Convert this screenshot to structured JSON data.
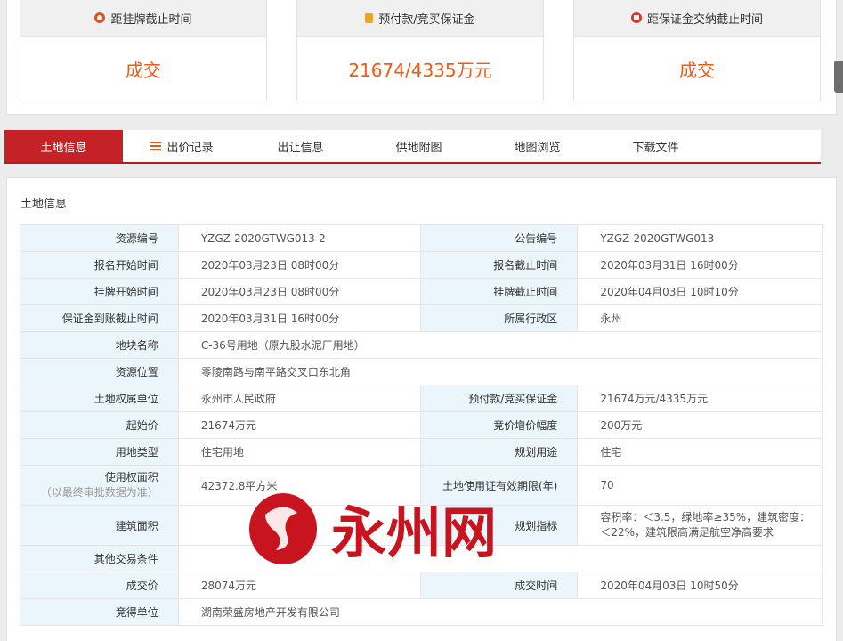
{
  "status_cards": [
    {
      "icon": "clock-icon",
      "label": "距挂牌截止时间",
      "value": "成交"
    },
    {
      "icon": "coin-icon",
      "label": "预付款/竞买保证金",
      "value": "21674/4335万元"
    },
    {
      "icon": "calendar-icon",
      "label": "距保证金交纳截止时间",
      "value": "成交"
    }
  ],
  "tabs": [
    {
      "label": "土地信息",
      "active": true
    },
    {
      "label": "出价记录",
      "icon": "list-icon"
    },
    {
      "label": "出让信息"
    },
    {
      "label": "供地附图"
    },
    {
      "label": "地图浏览"
    },
    {
      "label": "下载文件"
    }
  ],
  "panel": {
    "title": "土地信息",
    "rows": {
      "r1": {
        "l1": "资源编号",
        "v1": "YZGZ-2020GTWG013-2",
        "l2": "公告编号",
        "v2": "YZGZ-2020GTWG013"
      },
      "r2": {
        "l1": "报名开始时间",
        "v1": "2020年03月23日 08时00分",
        "l2": "报名截止时间",
        "v2": "2020年03月31日 16时00分"
      },
      "r3": {
        "l1": "挂牌开始时间",
        "v1": "2020年03月23日 08时00分",
        "l2": "挂牌截止时间",
        "v2": "2020年04月03日 10时10分"
      },
      "r4": {
        "l1": "保证金到账截止时间",
        "v1": "2020年03月31日 16时00分",
        "l2": "所属行政区",
        "v2": "永州"
      },
      "r5": {
        "l1": "地块名称",
        "v1": "C-36号用地（原九股水泥厂用地）"
      },
      "r6": {
        "l1": "资源位置",
        "v1": "零陵南路与南平路交叉口东北角"
      },
      "r7": {
        "l1": "土地权属单位",
        "v1": "永州市人民政府",
        "l2": "预付款/竞买保证金",
        "v2": "21674万元/4335万元"
      },
      "r8": {
        "l1": "起始价",
        "v1": "21674万元",
        "l2": "竞价增价幅度",
        "v2": "200万元"
      },
      "r9": {
        "l1": "用地类型",
        "v1": "住宅用地",
        "l2": "规划用途",
        "v2": "住宅"
      },
      "r10": {
        "l1": "使用权面积",
        "l1_sub": "（以最终审批数据为准）",
        "v1": "42372.8平方米",
        "l2": "土地使用证有效期限(年)",
        "v2": "70"
      },
      "r11": {
        "l1": "建筑面积",
        "v1": "",
        "l2": "规划指标",
        "v2": "容积率：＜3.5，绿地率≥35%，建筑密度：＜22%，建筑限高满足航空净高要求"
      },
      "r12": {
        "l1": "其他交易条件",
        "v1": ""
      },
      "r13": {
        "l1": "成交价",
        "v1": "28074万元",
        "l2": "成交时间",
        "v2": "2020年04月03日 10时50分"
      },
      "r14": {
        "l1": "竞得单位",
        "v1": "湖南荣盛房地产开发有限公司"
      }
    }
  },
  "watermark": {
    "text": "永州网",
    "color": "#c8141e"
  }
}
